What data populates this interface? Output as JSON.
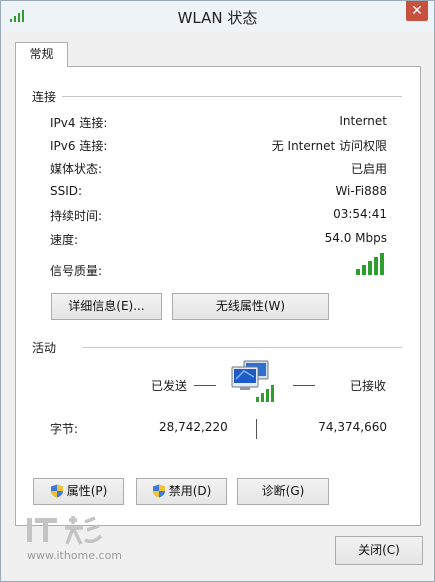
{
  "window": {
    "title": "WLAN 状态",
    "close_glyph": "✕"
  },
  "tabs": [
    {
      "label": "常规"
    }
  ],
  "connection": {
    "section_label": "连接",
    "rows": [
      {
        "label": "IPv4 连接:",
        "value": "Internet"
      },
      {
        "label": "IPv6 连接:",
        "value": "无 Internet 访问权限"
      },
      {
        "label": "媒体状态:",
        "value": "已启用"
      },
      {
        "label": "SSID:",
        "value": "Wi-Fi888"
      },
      {
        "label": "持续时间:",
        "value": "03:54:41"
      },
      {
        "label": "速度:",
        "value": "54.0 Mbps"
      }
    ],
    "signal_label": "信号质量:",
    "signal_bars_filled": 5,
    "signal_bars_total": 5,
    "details_button": "详细信息(E)...",
    "wireless_props_button": "无线属性(W)"
  },
  "activity": {
    "section_label": "活动",
    "sent_label": "已发送",
    "received_label": "已接收",
    "bytes_label": "字节:",
    "bytes_sent": "28,742,220",
    "bytes_received": "74,374,660"
  },
  "buttons": {
    "properties": "属性(P)",
    "disable": "禁用(D)",
    "diagnose": "诊断(G)",
    "close": "关闭(C)"
  },
  "watermark": {
    "logo_text": "IT之家",
    "url": "www.ithome.com"
  },
  "colors": {
    "signal_green": "#2e9e2e",
    "close_red": "#c7503e"
  }
}
